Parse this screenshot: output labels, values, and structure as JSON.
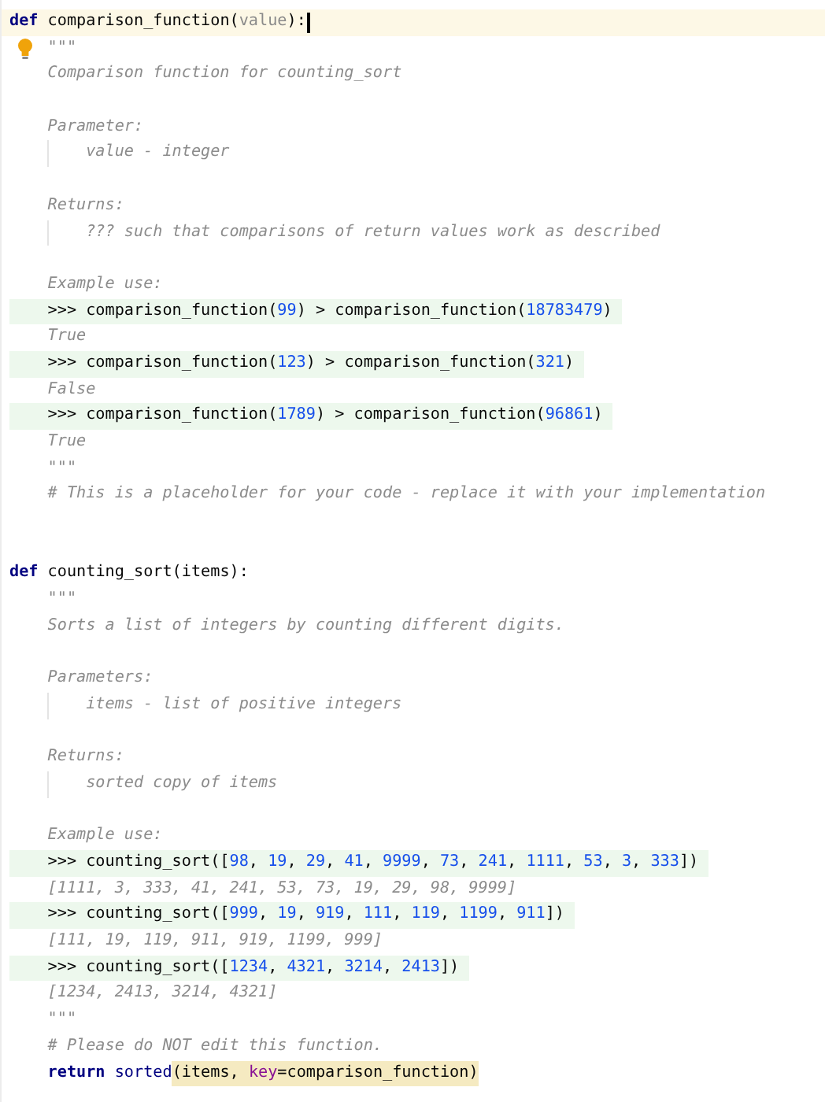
{
  "editor": {
    "lines": [
      {
        "kind": "code",
        "current": true,
        "bulb": false,
        "caret": true,
        "tokens": [
          {
            "kind": "keyword",
            "text": "def"
          },
          {
            "kind": "plain",
            "text": " comparison_function("
          },
          {
            "kind": "param",
            "text": "value"
          },
          {
            "kind": "plain",
            "text": "):"
          }
        ]
      },
      {
        "kind": "doc",
        "current": false,
        "bulb": true,
        "caret": false,
        "tokens": [
          {
            "kind": "doc",
            "text": "    \"\"\""
          }
        ]
      },
      {
        "kind": "doc",
        "current": false,
        "bulb": false,
        "caret": false,
        "tokens": [
          {
            "kind": "doc",
            "text": "    Comparison function for counting_sort"
          }
        ]
      },
      {
        "kind": "blank"
      },
      {
        "kind": "doc",
        "current": false,
        "bulb": false,
        "caret": false,
        "tokens": [
          {
            "kind": "doc",
            "text": "    Parameter:"
          }
        ]
      },
      {
        "kind": "doc",
        "current": false,
        "bulb": false,
        "caret": false,
        "tokens": [
          {
            "kind": "doc",
            "text": "        value - integer"
          }
        ]
      },
      {
        "kind": "blank"
      },
      {
        "kind": "doc",
        "current": false,
        "bulb": false,
        "caret": false,
        "tokens": [
          {
            "kind": "doc",
            "text": "    Returns:"
          }
        ]
      },
      {
        "kind": "doc",
        "current": false,
        "bulb": false,
        "caret": false,
        "tokens": [
          {
            "kind": "doc",
            "text": "        ??? such that comparisons of return values work as described"
          }
        ]
      },
      {
        "kind": "blank"
      },
      {
        "kind": "doc",
        "current": false,
        "bulb": false,
        "caret": false,
        "tokens": [
          {
            "kind": "doc",
            "text": "    Example use:"
          }
        ]
      },
      {
        "kind": "doctest",
        "current": false,
        "bulb": false,
        "caret": false,
        "tokens": [
          {
            "kind": "plain",
            "text": "    >>> comparison_function("
          },
          {
            "kind": "number",
            "text": "99"
          },
          {
            "kind": "plain",
            "text": ") > comparison_function("
          },
          {
            "kind": "number",
            "text": "18783479"
          },
          {
            "kind": "plain",
            "text": ")"
          }
        ]
      },
      {
        "kind": "doc",
        "current": false,
        "bulb": false,
        "caret": false,
        "tokens": [
          {
            "kind": "doc",
            "text": "    True"
          }
        ]
      },
      {
        "kind": "doctest",
        "current": false,
        "bulb": false,
        "caret": false,
        "tokens": [
          {
            "kind": "plain",
            "text": "    >>> comparison_function("
          },
          {
            "kind": "number",
            "text": "123"
          },
          {
            "kind": "plain",
            "text": ") > comparison_function("
          },
          {
            "kind": "number",
            "text": "321"
          },
          {
            "kind": "plain",
            "text": ")"
          }
        ]
      },
      {
        "kind": "doc",
        "current": false,
        "bulb": false,
        "caret": false,
        "tokens": [
          {
            "kind": "doc",
            "text": "    False"
          }
        ]
      },
      {
        "kind": "doctest",
        "current": false,
        "bulb": false,
        "caret": false,
        "tokens": [
          {
            "kind": "plain",
            "text": "    >>> comparison_function("
          },
          {
            "kind": "number",
            "text": "1789"
          },
          {
            "kind": "plain",
            "text": ") > comparison_function("
          },
          {
            "kind": "number",
            "text": "96861"
          },
          {
            "kind": "plain",
            "text": ")"
          }
        ]
      },
      {
        "kind": "doc",
        "current": false,
        "bulb": false,
        "caret": false,
        "tokens": [
          {
            "kind": "doc",
            "text": "    True"
          }
        ]
      },
      {
        "kind": "doc",
        "current": false,
        "bulb": false,
        "caret": false,
        "tokens": [
          {
            "kind": "doc",
            "text": "    \"\"\""
          }
        ]
      },
      {
        "kind": "comment",
        "current": false,
        "bulb": false,
        "caret": false,
        "tokens": [
          {
            "kind": "comment",
            "text": "    # This is a placeholder for your code - replace it with your implementation"
          }
        ]
      },
      {
        "kind": "blank"
      },
      {
        "kind": "blank"
      },
      {
        "kind": "code",
        "current": false,
        "bulb": false,
        "caret": false,
        "tokens": [
          {
            "kind": "keyword",
            "text": "def"
          },
          {
            "kind": "plain",
            "text": " counting_sort(items):"
          }
        ]
      },
      {
        "kind": "doc",
        "current": false,
        "bulb": false,
        "caret": false,
        "tokens": [
          {
            "kind": "doc",
            "text": "    \"\"\""
          }
        ]
      },
      {
        "kind": "doc",
        "current": false,
        "bulb": false,
        "caret": false,
        "tokens": [
          {
            "kind": "doc",
            "text": "    Sorts a list of integers by counting different digits."
          }
        ]
      },
      {
        "kind": "blank"
      },
      {
        "kind": "doc",
        "current": false,
        "bulb": false,
        "caret": false,
        "tokens": [
          {
            "kind": "doc",
            "text": "    Parameters:"
          }
        ]
      },
      {
        "kind": "doc",
        "current": false,
        "bulb": false,
        "caret": false,
        "tokens": [
          {
            "kind": "doc",
            "text": "        items - list of positive integers"
          }
        ]
      },
      {
        "kind": "blank"
      },
      {
        "kind": "doc",
        "current": false,
        "bulb": false,
        "caret": false,
        "tokens": [
          {
            "kind": "doc",
            "text": "    Returns:"
          }
        ]
      },
      {
        "kind": "doc",
        "current": false,
        "bulb": false,
        "caret": false,
        "tokens": [
          {
            "kind": "doc",
            "text": "        sorted copy of items"
          }
        ]
      },
      {
        "kind": "blank"
      },
      {
        "kind": "doc",
        "current": false,
        "bulb": false,
        "caret": false,
        "tokens": [
          {
            "kind": "doc",
            "text": "    Example use:"
          }
        ]
      },
      {
        "kind": "doctest",
        "current": false,
        "bulb": false,
        "caret": false,
        "tokens": [
          {
            "kind": "plain",
            "text": "    >>> counting_sort(["
          },
          {
            "kind": "number",
            "text": "98"
          },
          {
            "kind": "plain",
            "text": ", "
          },
          {
            "kind": "number",
            "text": "19"
          },
          {
            "kind": "plain",
            "text": ", "
          },
          {
            "kind": "number",
            "text": "29"
          },
          {
            "kind": "plain",
            "text": ", "
          },
          {
            "kind": "number",
            "text": "41"
          },
          {
            "kind": "plain",
            "text": ", "
          },
          {
            "kind": "number",
            "text": "9999"
          },
          {
            "kind": "plain",
            "text": ", "
          },
          {
            "kind": "number",
            "text": "73"
          },
          {
            "kind": "plain",
            "text": ", "
          },
          {
            "kind": "number",
            "text": "241"
          },
          {
            "kind": "plain",
            "text": ", "
          },
          {
            "kind": "number",
            "text": "1111"
          },
          {
            "kind": "plain",
            "text": ", "
          },
          {
            "kind": "number",
            "text": "53"
          },
          {
            "kind": "plain",
            "text": ", "
          },
          {
            "kind": "number",
            "text": "3"
          },
          {
            "kind": "plain",
            "text": ", "
          },
          {
            "kind": "number",
            "text": "333"
          },
          {
            "kind": "plain",
            "text": "])"
          }
        ]
      },
      {
        "kind": "doc",
        "current": false,
        "bulb": false,
        "caret": false,
        "tokens": [
          {
            "kind": "doc",
            "text": "    [1111, 3, 333, 41, 241, 53, 73, 19, 29, 98, 9999]"
          }
        ]
      },
      {
        "kind": "doctest",
        "current": false,
        "bulb": false,
        "caret": false,
        "tokens": [
          {
            "kind": "plain",
            "text": "    >>> counting_sort(["
          },
          {
            "kind": "number",
            "text": "999"
          },
          {
            "kind": "plain",
            "text": ", "
          },
          {
            "kind": "number",
            "text": "19"
          },
          {
            "kind": "plain",
            "text": ", "
          },
          {
            "kind": "number",
            "text": "919"
          },
          {
            "kind": "plain",
            "text": ", "
          },
          {
            "kind": "number",
            "text": "111"
          },
          {
            "kind": "plain",
            "text": ", "
          },
          {
            "kind": "number",
            "text": "119"
          },
          {
            "kind": "plain",
            "text": ", "
          },
          {
            "kind": "number",
            "text": "1199"
          },
          {
            "kind": "plain",
            "text": ", "
          },
          {
            "kind": "number",
            "text": "911"
          },
          {
            "kind": "plain",
            "text": "])"
          }
        ]
      },
      {
        "kind": "doc",
        "current": false,
        "bulb": false,
        "caret": false,
        "tokens": [
          {
            "kind": "doc",
            "text": "    [111, 19, 119, 911, 919, 1199, 999]"
          }
        ]
      },
      {
        "kind": "doctest",
        "current": false,
        "bulb": false,
        "caret": false,
        "tokens": [
          {
            "kind": "plain",
            "text": "    >>> counting_sort(["
          },
          {
            "kind": "number",
            "text": "1234"
          },
          {
            "kind": "plain",
            "text": ", "
          },
          {
            "kind": "number",
            "text": "4321"
          },
          {
            "kind": "plain",
            "text": ", "
          },
          {
            "kind": "number",
            "text": "3214"
          },
          {
            "kind": "plain",
            "text": ", "
          },
          {
            "kind": "number",
            "text": "2413"
          },
          {
            "kind": "plain",
            "text": "])"
          }
        ]
      },
      {
        "kind": "doc",
        "current": false,
        "bulb": false,
        "caret": false,
        "tokens": [
          {
            "kind": "doc",
            "text": "    [1234, 2413, 3214, 4321]"
          }
        ]
      },
      {
        "kind": "doc",
        "current": false,
        "bulb": false,
        "caret": false,
        "tokens": [
          {
            "kind": "doc",
            "text": "    \"\"\""
          }
        ]
      },
      {
        "kind": "comment",
        "current": false,
        "bulb": false,
        "caret": false,
        "tokens": [
          {
            "kind": "comment",
            "text": "    # Please do NOT edit this function."
          }
        ]
      },
      {
        "kind": "code",
        "current": false,
        "bulb": false,
        "caret": false,
        "tokens": [
          {
            "kind": "keyword",
            "text": "    return",
            "highlighted": false
          },
          {
            "kind": "builtin",
            "text": " sorted",
            "highlighted": false
          },
          {
            "kind": "plain",
            "text": "(items, ",
            "highlighted": true
          },
          {
            "kind": "kwarg",
            "text": "key",
            "highlighted": true
          },
          {
            "kind": "plain",
            "text": "=comparison_function)",
            "highlighted": true
          }
        ]
      }
    ]
  }
}
